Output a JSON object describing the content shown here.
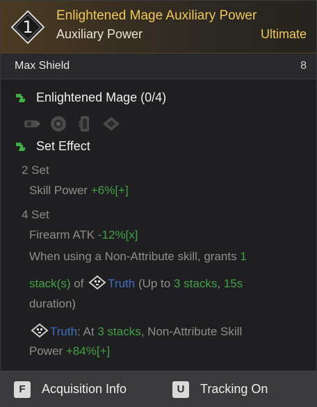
{
  "header": {
    "tier_number": "1",
    "title": "Enlightened Mage Auxiliary Power",
    "subtitle": "Auxiliary Power",
    "grade": "Ultimate"
  },
  "stat": {
    "label": "Max Shield",
    "value": "8"
  },
  "set": {
    "name": "Enlightened Mage (0/4)",
    "pieces": [
      "auxiliary-power-icon",
      "sensor-icon",
      "memory-icon",
      "processor-icon"
    ]
  },
  "set_effect": {
    "title": "Set Effect",
    "two_set": {
      "label": "2 Set",
      "stat": "Skill Power",
      "bonus": "+6%[+]"
    },
    "four_set": {
      "label": "4 Set",
      "stat": "Firearm ATK",
      "bonus": "-12%[x]",
      "desc_a": "When using a Non-Attribute skill, grants",
      "desc_a_num": "1",
      "desc_b_num": "stack(s)",
      "desc_b_of": "of",
      "desc_b_truth": "Truth",
      "desc_b_upto": "(Up to",
      "desc_b_stacks": "3 stacks",
      "desc_b_comma": ",",
      "desc_b_dur": "15s",
      "desc_c": "duration)",
      "desc_d_truth": "Truth",
      "desc_d_at": ": At",
      "desc_d_stacks": "3 stacks",
      "desc_d_rest": ", Non-Attribute Skill",
      "desc_e": "Power",
      "desc_e_bonus": "+84%[+]"
    }
  },
  "footer": {
    "acq_key": "F",
    "acq_label": "Acquisition Info",
    "track_key": "U",
    "track_label": "Tracking On"
  },
  "colors": {
    "gold": "#f0c75a",
    "green": "#43a047",
    "blue": "#3f6fbf"
  }
}
